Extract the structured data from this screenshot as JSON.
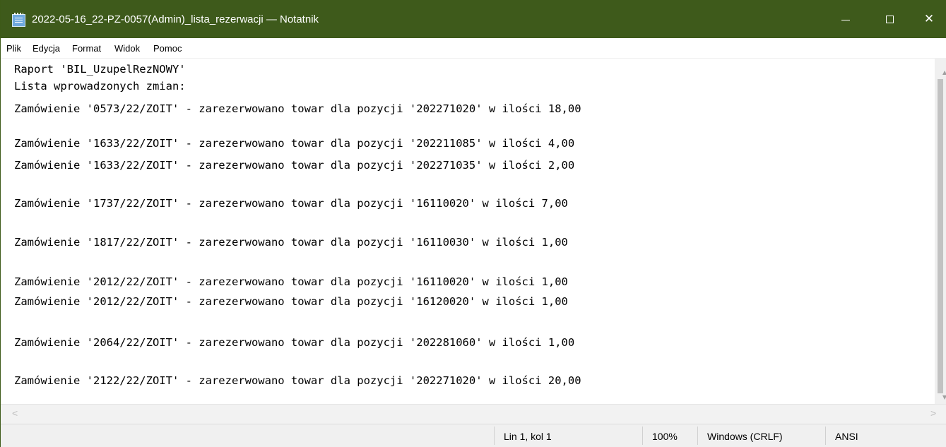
{
  "window": {
    "title": "2022-05-16_22-PZ-0057(Admin)_lista_rezerwacji — Notatnik",
    "colors": {
      "titlebar": "#3e5a1b",
      "titlebar_text": "#ffffff"
    },
    "app_icon": "notepad-icon",
    "minimize_glyph": "",
    "maximize_glyph": "",
    "close_glyph": "✕"
  },
  "menu": [
    "Plik",
    "Edycja",
    "Format",
    "Widok",
    "Pomoc"
  ],
  "editor": {
    "lines": [
      "Raport 'BIL_UzupelRezNOWY'",
      "Lista wprowadzonych zmian:",
      "Zamówienie '0573/22/ZOIT' - zarezerwowano towar dla pozycji '202271020' w ilości 18,00",
      "",
      "Zamówienie '1633/22/ZOIT' - zarezerwowano towar dla pozycji '202211085' w ilości 4,00",
      "Zamówienie '1633/22/ZOIT' - zarezerwowano towar dla pozycji '202271035' w ilości 2,00",
      "",
      "Zamówienie '1737/22/ZOIT' - zarezerwowano towar dla pozycji '16110020' w ilości 7,00",
      "",
      "Zamówienie '1817/22/ZOIT' - zarezerwowano towar dla pozycji '16110030' w ilości 1,00",
      "",
      "Zamówienie '2012/22/ZOIT' - zarezerwowano towar dla pozycji '16110020' w ilości 1,00",
      "Zamówienie '2012/22/ZOIT' - zarezerwowano towar dla pozycji '16120020' w ilości 1,00",
      "",
      "Zamówienie '2064/22/ZOIT' - zarezerwowano towar dla pozycji '202281060' w ilości 1,00",
      "",
      "Zamówienie '2122/22/ZOIT' - zarezerwowano towar dla pozycji '202271020' w ilości 20,00"
    ]
  },
  "scrollbar": {
    "left_arrow": "<",
    "right_arrow": ">",
    "up_arrow": "▲",
    "down_arrow": "▼"
  },
  "status": {
    "position": "Lin 1, kol 1",
    "zoom": "100%",
    "line_ending": "Windows (CRLF)",
    "encoding": "ANSI"
  }
}
